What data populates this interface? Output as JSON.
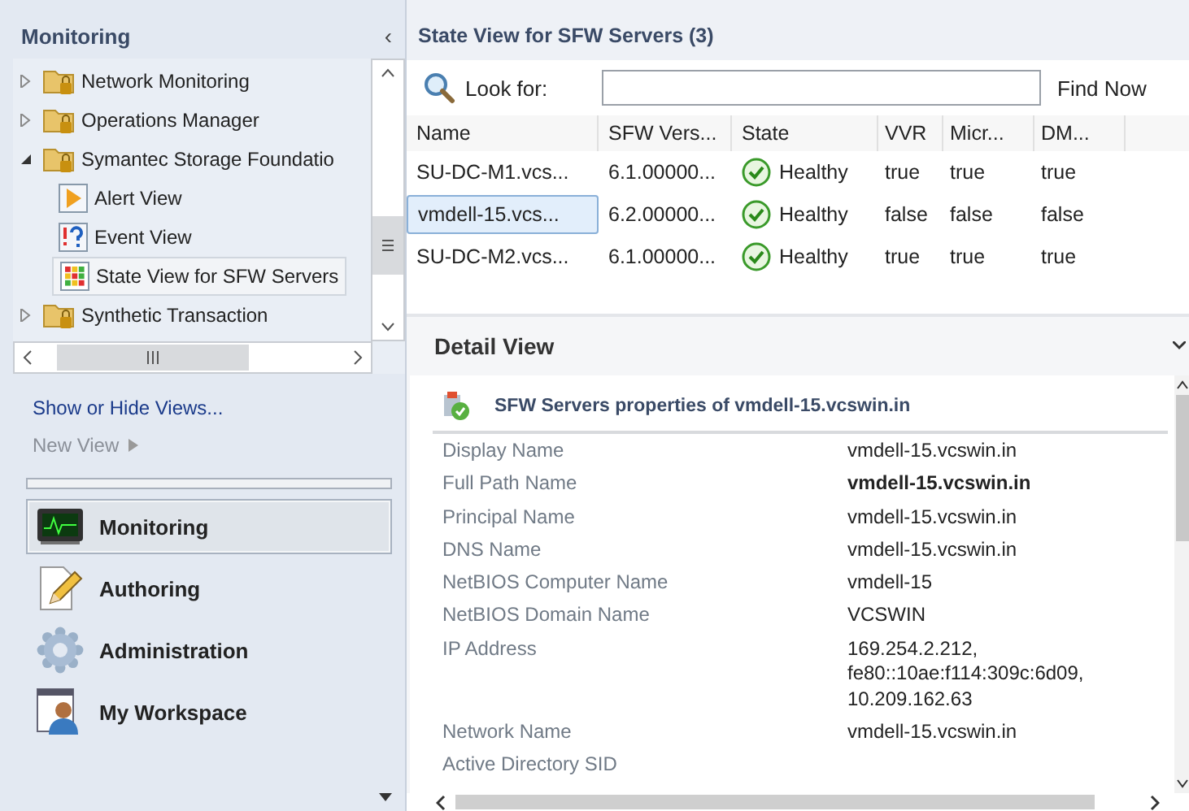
{
  "sidebar": {
    "title": "Monitoring",
    "collapse": "‹",
    "tree": [
      {
        "label": "Network Monitoring",
        "kind": "folder",
        "expanded": false
      },
      {
        "label": "Operations Manager",
        "kind": "folder",
        "expanded": false
      },
      {
        "label": "Symantec Storage Foundatio",
        "kind": "folder",
        "expanded": true,
        "children": [
          {
            "label": "Alert View",
            "kind": "alert",
            "selected": false
          },
          {
            "label": "Event View",
            "kind": "event",
            "selected": false
          },
          {
            "label": "State View for SFW Servers",
            "kind": "state",
            "selected": true
          }
        ]
      },
      {
        "label": "Synthetic Transaction",
        "kind": "folder",
        "expanded": false
      }
    ],
    "links": [
      {
        "label": "Show or Hide Views...",
        "disabled": false,
        "submenu": false
      },
      {
        "label": "New View",
        "disabled": true,
        "submenu": true
      }
    ],
    "nav": [
      {
        "label": "Monitoring",
        "kind": "monitor",
        "selected": true
      },
      {
        "label": "Authoring",
        "kind": "pencil",
        "selected": false
      },
      {
        "label": "Administration",
        "kind": "gear",
        "selected": false
      },
      {
        "label": "My Workspace",
        "kind": "workspace",
        "selected": false
      }
    ]
  },
  "main": {
    "title": "State View for SFW Servers (3)",
    "search": {
      "label": "Look for:",
      "button": "Find Now"
    },
    "table": {
      "columns": [
        "Name",
        "SFW Vers...",
        "State",
        "VVR",
        "Micr...",
        "DM..."
      ],
      "rows": [
        {
          "selected": false,
          "cells": [
            "SU-DC-M1.vcs...",
            "6.1.00000...",
            "Healthy",
            "true",
            "true",
            "true"
          ]
        },
        {
          "selected": true,
          "cells": [
            "vmdell-15.vcs...",
            "6.2.00000...",
            "Healthy",
            "false",
            "false",
            "false"
          ]
        },
        {
          "selected": false,
          "cells": [
            "SU-DC-M2.vcs...",
            "6.1.00000...",
            "Healthy",
            "true",
            "true",
            "true"
          ]
        }
      ]
    },
    "detail": {
      "title": "Detail View",
      "heading": "SFW Servers properties of vmdell-15.vcswin.in",
      "properties": [
        {
          "name": "Display Name",
          "value": "vmdell-15.vcswin.in"
        },
        {
          "name": "Full Path Name",
          "value": "vmdell-15.vcswin.in",
          "bold": true
        },
        {
          "name": "Principal Name",
          "value": "vmdell-15.vcswin.in"
        },
        {
          "name": "DNS Name",
          "value": "vmdell-15.vcswin.in"
        },
        {
          "name": "NetBIOS Computer Name",
          "value": "vmdell-15"
        },
        {
          "name": "NetBIOS Domain Name",
          "value": "VCSWIN"
        },
        {
          "name": "IP Address",
          "value": "169.254.2.212,\nfe80::10ae:f114:309c:6d09,\n10.209.162.63"
        },
        {
          "name": "Network Name",
          "value": "vmdell-15.vcswin.in"
        },
        {
          "name": "Active Directory SID"
        }
      ]
    }
  }
}
